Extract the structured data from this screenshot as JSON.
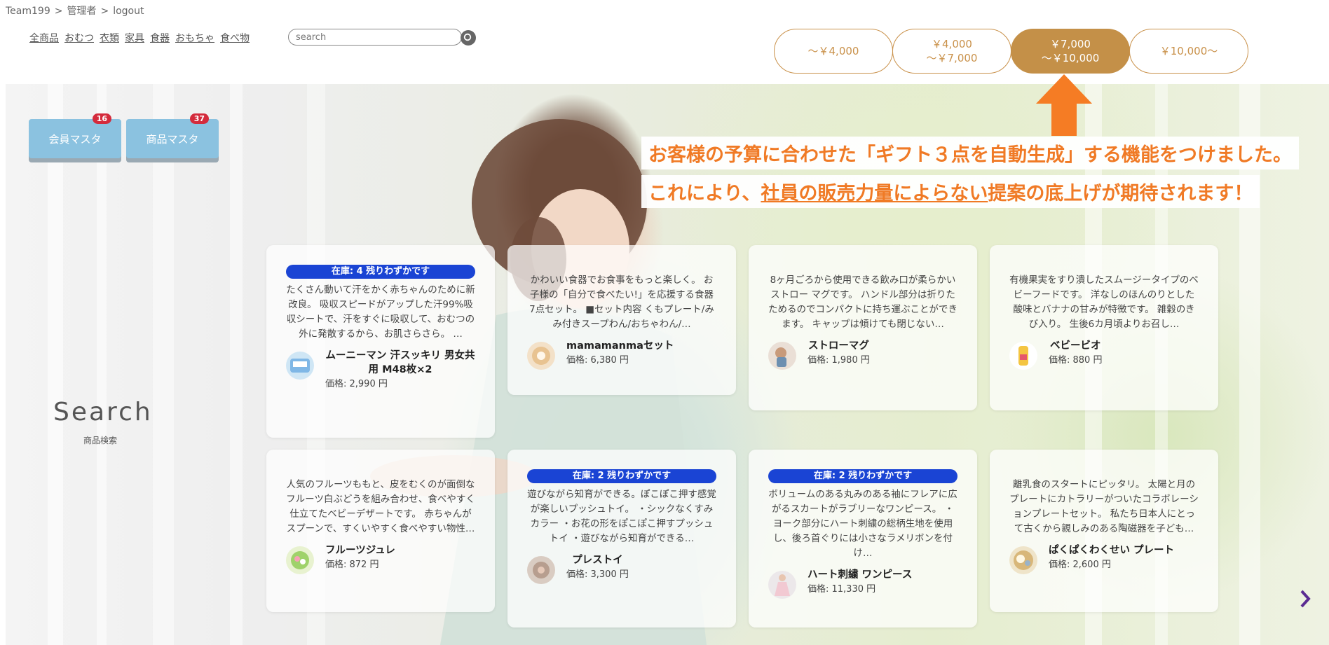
{
  "breadcrumb": {
    "team": "Team199",
    "admin": "管理者",
    "logout": "logout",
    "sep": ">"
  },
  "categories": [
    "全商品",
    "おむつ",
    "衣類",
    "家具",
    "食器",
    "おもちゃ",
    "食べ物"
  ],
  "search": {
    "placeholder": "search"
  },
  "price_ranges": [
    {
      "line1": "～￥4,000",
      "line2": "",
      "active": false
    },
    {
      "line1": "￥4,000",
      "line2": "～￥7,000",
      "active": false
    },
    {
      "line1": "￥7,000",
      "line2": "～￥10,000",
      "active": true
    },
    {
      "line1": "￥10,000～",
      "line2": "",
      "active": false
    }
  ],
  "masters": [
    {
      "label": "会員マスタ",
      "badge": "16"
    },
    {
      "label": "商品マスタ",
      "badge": "37"
    }
  ],
  "side": {
    "title": "Search",
    "subtitle": "商品検索"
  },
  "annotation": {
    "line1": "お客様の予算に合わせた「ギフト３点を自動生成」する機能をつけました。",
    "line2_a": "これにより、",
    "line2_u": "社員の販売力量によらない",
    "line2_b": "提案の底上げが期待されます！"
  },
  "products": [
    {
      "stock": "在庫: 4 残りわずかです",
      "desc": "たくさん動いて汗をかく赤ちゃんのために新改良。 吸収スピードがアップした汗99%吸収シートで、汗をすぐに吸収して、おむつの外に発散するから、お肌さらさら。 …",
      "name": "ムーニーマン 汗スッキリ 男女共用 M48枚×2",
      "price": "価格: 2,990 円"
    },
    {
      "stock": "",
      "desc": "かわいい食器でお食事をもっと楽しく。 お子様の「自分で食べたい!」を応援する食器7点セット。 ■セット内容 くもプレート/みみ付きスープわん/おちゃわん/…",
      "name": "mamamanmaセット",
      "price": "価格: 6,380 円"
    },
    {
      "stock": "",
      "desc": "8ヶ月ごろから使用できる飲み口が柔らかいストロー マグです。 ハンドル部分は折りたためるのでコンパクトに持ち運ぶことができます。 キャップは傾けても閉じない…",
      "name": "ストローマグ",
      "price": "価格: 1,980 円"
    },
    {
      "stock": "",
      "desc": "有機果実をすり潰したスムージータイプのベビーフードです。 洋なしのほんのりとした酸味とバナナの甘みが特徴です。 雑穀のきび入り。 生後6カ月頃よりお召し…",
      "name": "ベビービオ",
      "price": "価格: 880 円"
    },
    {
      "stock": "",
      "desc": "人気のフルーツももと、皮をむくのが面倒なフルーツ白ぶどうを組み合わせ、食べやすく仕立てたベビーデザートです。 赤ちゃんがスプーンで、すくいやすく食べやすい物性…",
      "name": "フルーツジュレ",
      "price": "価格: 872 円"
    },
    {
      "stock": "在庫: 2 残りわずかです",
      "desc": "遊びながら知育ができる。ぽこぽこ押す感覚が楽しいプッシュトイ。 ・シックなくすみカラー ・お花の形をぽこぽこ押すプッシュトイ ・遊びながら知育ができる…",
      "name": "プレストイ",
      "price": "価格: 3,300 円"
    },
    {
      "stock": "在庫: 2 残りわずかです",
      "desc": "ボリュームのある丸みのある袖にフレアに広がるスカートがラブリーなワンピース。 ・ヨーク部分にハート刺繍の総柄生地を使用し、後ろ首ぐりには小さなラメリボンを付け…",
      "name": "ハート刺繍 ワンピース",
      "price": "価格: 11,330 円"
    },
    {
      "stock": "",
      "desc": "離乳食のスタートにピッタリ。 太陽と月のプレートにカトラリーがついたコラボレーションプレートセット。 私たち日本人にとって古くから親しみのある陶磁器を子ども…",
      "name": "ぱくぱくわくせい プレート",
      "price": "価格: 2,600 円"
    }
  ],
  "colors": {
    "accent": "#c49048",
    "annotation": "#f07a25",
    "stock": "#1a44d4",
    "master": "#8bc2e0"
  }
}
